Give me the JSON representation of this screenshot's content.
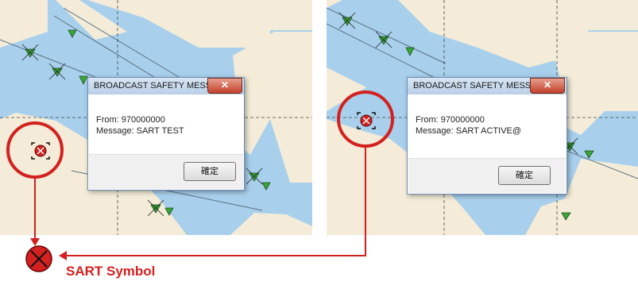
{
  "colors": {
    "sea": "#a8d0ec",
    "land": "#f4ecd8",
    "highlight_red": "#d3211f",
    "ship_green": "#3aa63a"
  },
  "left_dialog": {
    "title": "BROADCAST SAFETY MESSA...",
    "close_glyph": "✕",
    "from_line": "From: 970000000",
    "message_line": "Message: SART TEST",
    "ok_label": "確定"
  },
  "right_dialog": {
    "title": "BROADCAST SAFETY MESSA...",
    "close_glyph": "✕",
    "from_line": "From: 970000000",
    "message_line": "Message: SART ACTIVE@",
    "ok_label": "確定"
  },
  "legend": {
    "label": "SART Symbol",
    "icon": "sart-icon"
  }
}
